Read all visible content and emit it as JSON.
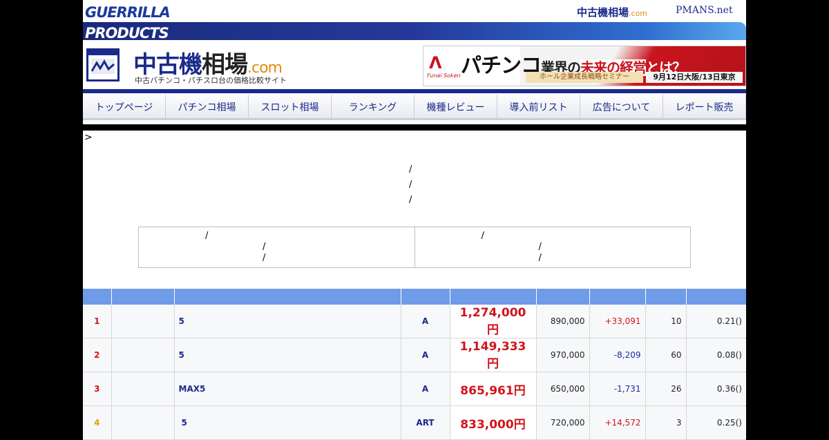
{
  "header": {
    "brand_line1": "GUERRILLA",
    "brand_line2": "PRODUCTS",
    "top_link_1": "中古機相場",
    "top_link_1_suffix": ".com",
    "top_link_2": "PMANS.net",
    "site_title_blue": "中古機",
    "site_title_dark": "相場",
    "site_title_suffix": ".com",
    "site_subtitle": "中古パチンコ・パチスロ台の価格比較サイト"
  },
  "ad": {
    "logo_mark": "ᐱ",
    "logo_text": "Funai Soken",
    "title_main": "パチンコ",
    "title_part1": "業界の",
    "title_part2": "未来の経営",
    "title_part3": "とは？",
    "seminar": "ホール企業成長戦略セミナー",
    "date": "9月12日大阪/13日東京"
  },
  "nav": {
    "items": [
      {
        "label": "トップページ"
      },
      {
        "label": "パチンコ相場"
      },
      {
        "label": "スロット相場"
      },
      {
        "label": "ランキング"
      },
      {
        "label": "機種レビュー"
      },
      {
        "label": "導入前リスト"
      },
      {
        "label": "広告について"
      },
      {
        "label": "レポート販売"
      }
    ]
  },
  "content": {
    "breadcrumb_mark": ">",
    "slash": "/"
  },
  "table": {
    "rows": [
      {
        "rank": "1",
        "name": "5",
        "type": "A",
        "price": "1,274,000円",
        "base": "890,000",
        "diff": "+33,091",
        "diff_dir": "up",
        "count": "10",
        "ratio": "0.21()"
      },
      {
        "rank": "2",
        "name": "5",
        "type": "A",
        "price": "1,149,333円",
        "base": "970,000",
        "diff": "-8,209",
        "diff_dir": "down",
        "count": "60",
        "ratio": "0.08()"
      },
      {
        "rank": "3",
        "name": "MAX5",
        "type": "A",
        "price": "865,961円",
        "base": "650,000",
        "diff": "-1,731",
        "diff_dir": "down",
        "count": "26",
        "ratio": "0.36()"
      },
      {
        "rank": "4",
        "name": "5",
        "type": "ART",
        "price": "833,000円",
        "base": "720,000",
        "diff": "+14,572",
        "diff_dir": "up",
        "count": "3",
        "ratio": "0.25()"
      }
    ]
  },
  "colors": {
    "brand_blue": "#1a2a8a",
    "accent_orange": "#e58a10",
    "price_red": "#d0141c",
    "table_header": "#6f9be8"
  }
}
